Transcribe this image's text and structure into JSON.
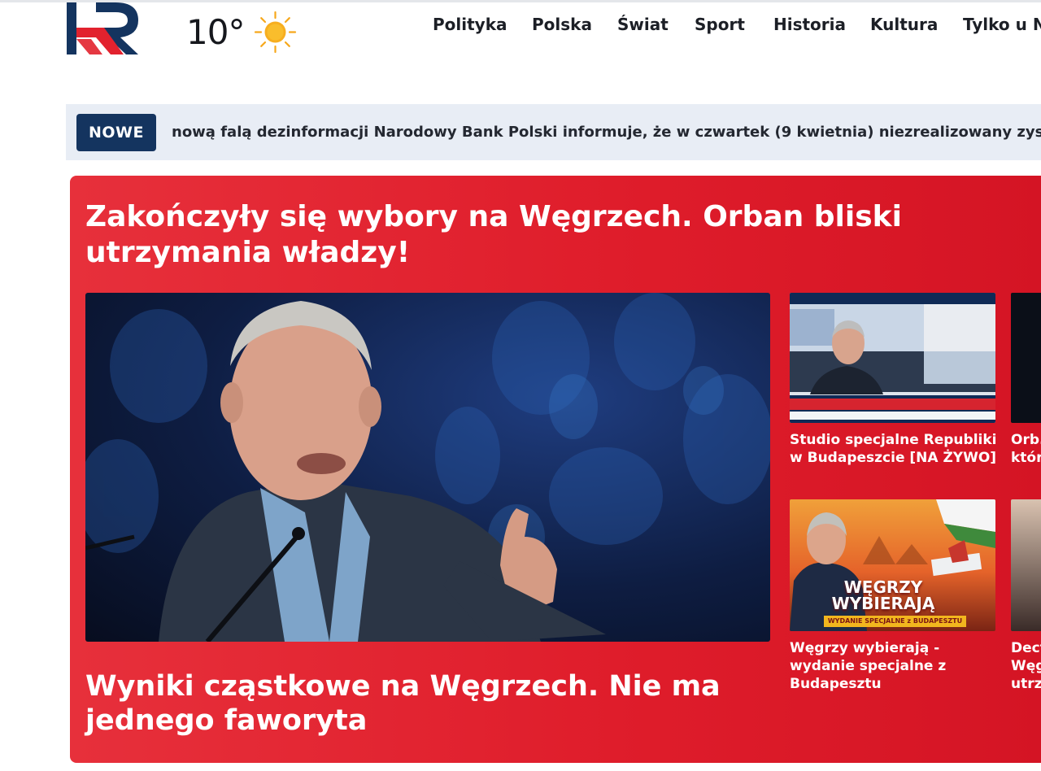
{
  "header": {
    "weather": {
      "temperature": "10°",
      "icon": "sun-icon"
    },
    "nav": [
      "Polityka",
      "Polska",
      "Świat",
      "Sport",
      "Historia",
      "Kultura",
      "Tylko u Nas"
    ]
  },
  "ticker": {
    "badge": "NOWE",
    "text": "nową falą dezinformacji Narodowy Bank Polski informuje, że w czwartek (9 kwietnia) niezrealizowany zysk na rezerwach"
  },
  "hero": {
    "title": "Zakończyły się wybory na Węgrzech. Orban bliski utrzymania władzy!",
    "main_article": {
      "caption": "Wyniki cząstkowe na Węgrzech. Nie ma jednego faworyta"
    },
    "side_articles": [
      {
        "caption": "Studio specjalne Republiki w Budapeszcie [NA ŻYWO]"
      },
      {
        "caption": "Orb... któr..."
      },
      {
        "caption": "Węgrzy wybierają - wydanie specjalne z Budapesztu",
        "thumb_banner": [
          "WĘGRZY",
          "WYBIERAJĄ"
        ],
        "thumb_strip": "WYDANIE SPECJALNE z BUDAPESZTU"
      },
      {
        "caption": "Dect... Węg... utrz..."
      }
    ]
  },
  "colors": {
    "accent_red": "#e02230",
    "navy": "#14345f",
    "ticker_bg": "#e8edf5"
  }
}
